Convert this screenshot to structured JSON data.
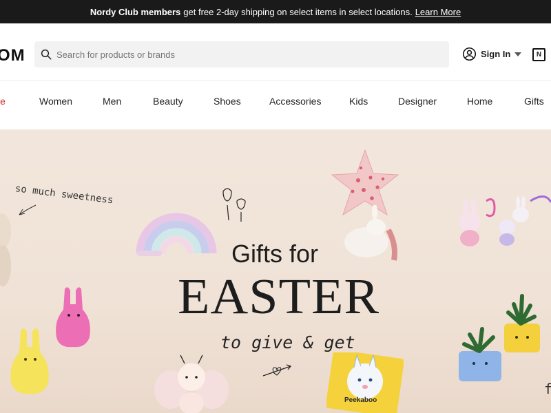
{
  "promo": {
    "bold": "Nordy Club members",
    "text": "get free 2-day shipping on select items in select locations.",
    "link": "Learn More"
  },
  "header": {
    "logo_text": "OM",
    "search_placeholder": "Search for products or brands",
    "sign_in": "Sign In",
    "bag_label": "N"
  },
  "nav": {
    "items": [
      "le",
      "Women",
      "Men",
      "Beauty",
      "Shoes",
      "Accessories",
      "Kids",
      "Designer",
      "Home",
      "Gifts"
    ]
  },
  "hero": {
    "note": "so much sweetness",
    "subtitle": "Gifts for",
    "title": "EASTER",
    "tagline": "to give & get",
    "package_label": "Peekaboo",
    "edge_text": "fi"
  },
  "colors": {
    "sale": "#d12d2d",
    "hero_bg": "#f0e2d6",
    "promo_bg": "#1a1a1a"
  }
}
